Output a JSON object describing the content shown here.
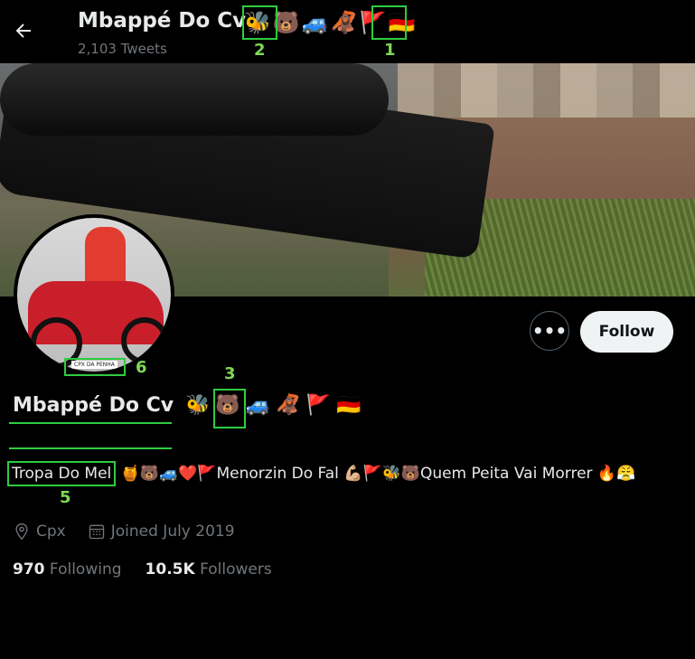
{
  "header": {
    "name": "Mbappé Do Cv",
    "emojis": [
      "🐝",
      "🐻",
      "🚙",
      "🦧",
      "🚩",
      "🇩🇪"
    ],
    "tweet_count": "2,103 Tweets"
  },
  "annotations": {
    "a1": "1",
    "a2": "2",
    "a3": "3",
    "a5": "5",
    "a6": "6"
  },
  "avatar": {
    "patch_text": "CPX DA PENHA"
  },
  "actions": {
    "more": "•••",
    "follow": "Follow"
  },
  "profile": {
    "display_name": "Mbappé Do Cv",
    "name_emojis": [
      "🐝",
      "🐻",
      "🚙",
      "🦧",
      "🚩",
      "🇩🇪"
    ],
    "bio_highlight": "Tropa Do Mel",
    "bio_rest": "🍯🐻🚙❤️🚩Menorzin Do Fal 💪🏼🚩🐝🐻Quem Peita Vai Morrer 🔥😤",
    "location": "Cpx",
    "joined": "Joined July 2019",
    "following_count": "970",
    "following_label": "Following",
    "followers_count": "10.5K",
    "followers_label": "Followers"
  }
}
